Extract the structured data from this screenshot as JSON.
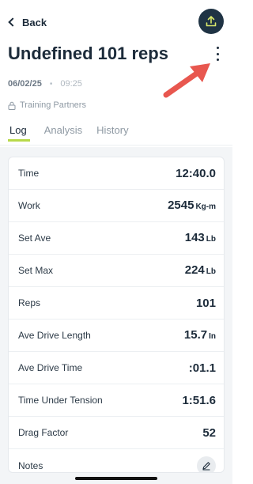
{
  "nav": {
    "back_label": "Back",
    "share_icon": "upload-icon"
  },
  "header": {
    "title": "Undefined 101 reps",
    "more_icon": "more-vertical-icon"
  },
  "meta": {
    "date": "06/02/25",
    "separator": "•",
    "time": "09:25"
  },
  "partners": {
    "label": "Training Partners",
    "icon": "lock-icon"
  },
  "tabs": [
    {
      "label": "Log",
      "active": true
    },
    {
      "label": "Analysis",
      "active": false
    },
    {
      "label": "History",
      "active": false
    }
  ],
  "stats": [
    {
      "label": "Time",
      "value": "12:40.0",
      "unit": ""
    },
    {
      "label": "Work",
      "value": "2545",
      "unit": "Kg-m"
    },
    {
      "label": "Set Ave",
      "value": "143",
      "unit": "Lb"
    },
    {
      "label": "Set Max",
      "value": "224",
      "unit": "Lb"
    },
    {
      "label": "Reps",
      "value": "101",
      "unit": ""
    },
    {
      "label": "Ave Drive Length",
      "value": "15.7",
      "unit": "In"
    },
    {
      "label": "Ave Drive Time",
      "value": ":01.1",
      "unit": ""
    },
    {
      "label": "Time Under Tension",
      "value": "1:51.6",
      "unit": ""
    },
    {
      "label": "Drag Factor",
      "value": "52",
      "unit": ""
    }
  ],
  "notes": {
    "label": "Notes",
    "icon": "pencil-icon"
  },
  "colors": {
    "accent": "#b8d94a",
    "share_button": "#1f3344",
    "annotation_arrow": "#e8574f"
  }
}
